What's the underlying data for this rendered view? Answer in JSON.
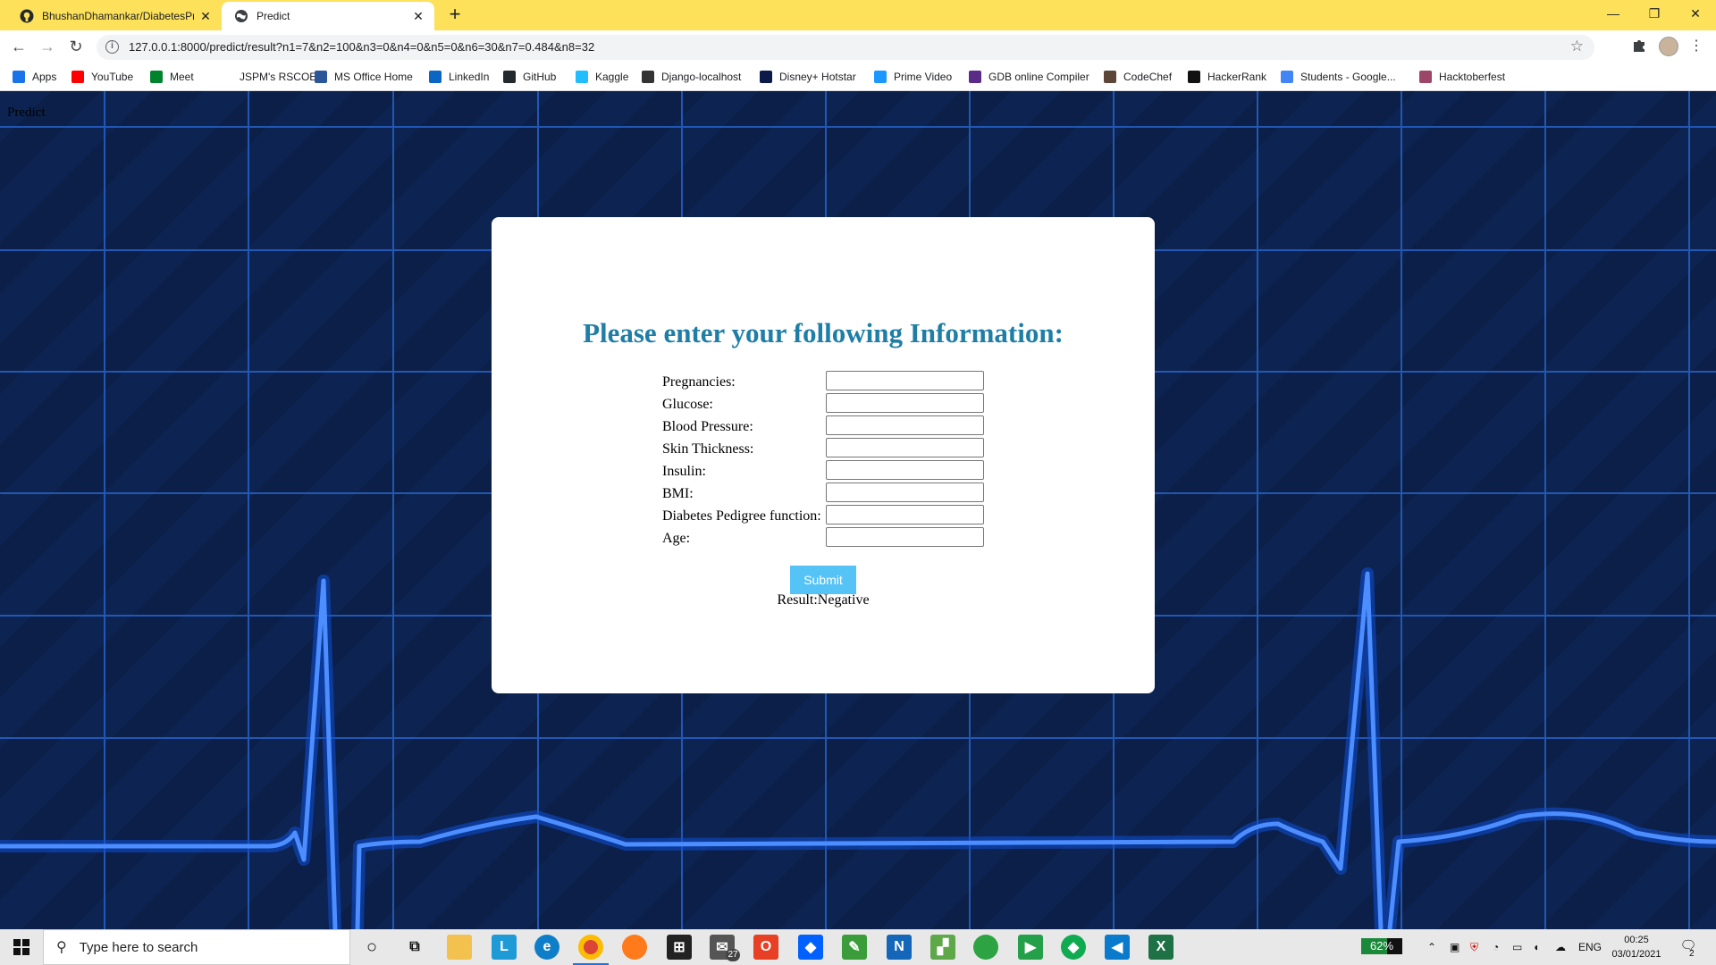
{
  "browser": {
    "tabs": [
      {
        "title": "BhushanDhamankar/DiabetesPre",
        "active": false,
        "icon": "github-icon"
      },
      {
        "title": "Predict",
        "active": true,
        "icon": "globe-icon"
      }
    ],
    "url": "127.0.0.1:8000/predict/result?n1=7&n2=100&n3=0&n4=0&n5=0&n6=30&n7=0.484&n8=32",
    "bookmarks": [
      {
        "label": "Apps",
        "icon": "apps-grid-icon",
        "color": "#1a73e8"
      },
      {
        "label": "YouTube",
        "icon": "youtube-icon",
        "color": "#ff0000"
      },
      {
        "label": "Meet",
        "icon": "meet-icon",
        "color": "#00832d"
      },
      {
        "label": "JSPM's RSCOE",
        "icon": "blank-icon",
        "color": "#ffffff"
      },
      {
        "label": "MS Office Home",
        "icon": "word-icon",
        "color": "#2b579a"
      },
      {
        "label": "LinkedIn",
        "icon": "linkedin-icon",
        "color": "#0a66c2"
      },
      {
        "label": "GitHub",
        "icon": "github-icon",
        "color": "#24292e"
      },
      {
        "label": "Kaggle",
        "icon": "kaggle-icon",
        "color": "#20beff"
      },
      {
        "label": "Django-localhost",
        "icon": "globe-icon",
        "color": "#333333"
      },
      {
        "label": "Disney+ Hotstar",
        "icon": "hotstar-icon",
        "color": "#0c1a4a"
      },
      {
        "label": "Prime Video",
        "icon": "prime-video-icon",
        "color": "#1a98ff"
      },
      {
        "label": "GDB online Compiler",
        "icon": "gdb-icon",
        "color": "#5b2c87"
      },
      {
        "label": "CodeChef",
        "icon": "codechef-icon",
        "color": "#5b4638"
      },
      {
        "label": "HackerRank",
        "icon": "hackerrank-icon",
        "color": "#111111"
      },
      {
        "label": "Students - Google...",
        "icon": "google-icon",
        "color": "#4285f4"
      },
      {
        "label": "Hacktoberfest",
        "icon": "hacktoberfest-icon",
        "color": "#9c4668"
      }
    ]
  },
  "page": {
    "title": "Predict",
    "heading": "Please enter your following Information:",
    "fields": [
      {
        "label": "Pregnancies:",
        "value": ""
      },
      {
        "label": "Glucose:",
        "value": ""
      },
      {
        "label": "Blood Pressure:",
        "value": ""
      },
      {
        "label": "Skin Thickness:",
        "value": ""
      },
      {
        "label": "Insulin:",
        "value": ""
      },
      {
        "label": "BMI:",
        "value": ""
      },
      {
        "label": "Diabetes Pedigree function:",
        "value": ""
      },
      {
        "label": "Age:",
        "value": ""
      }
    ],
    "submit_label": "Submit",
    "result_text": "Result:Negative"
  },
  "taskbar": {
    "search_placeholder": "Type here to search",
    "mail_badge": "27",
    "battery_percent": 62,
    "battery_label": "62%",
    "language": "ENG",
    "time": "00:25",
    "date": "03/01/2021",
    "notification_count": "2"
  },
  "colors": {
    "tab_bar": "#fde15a",
    "heading": "#1f7ea6",
    "submit": "#55c3f5",
    "ecg_line": "#2f7bff"
  }
}
